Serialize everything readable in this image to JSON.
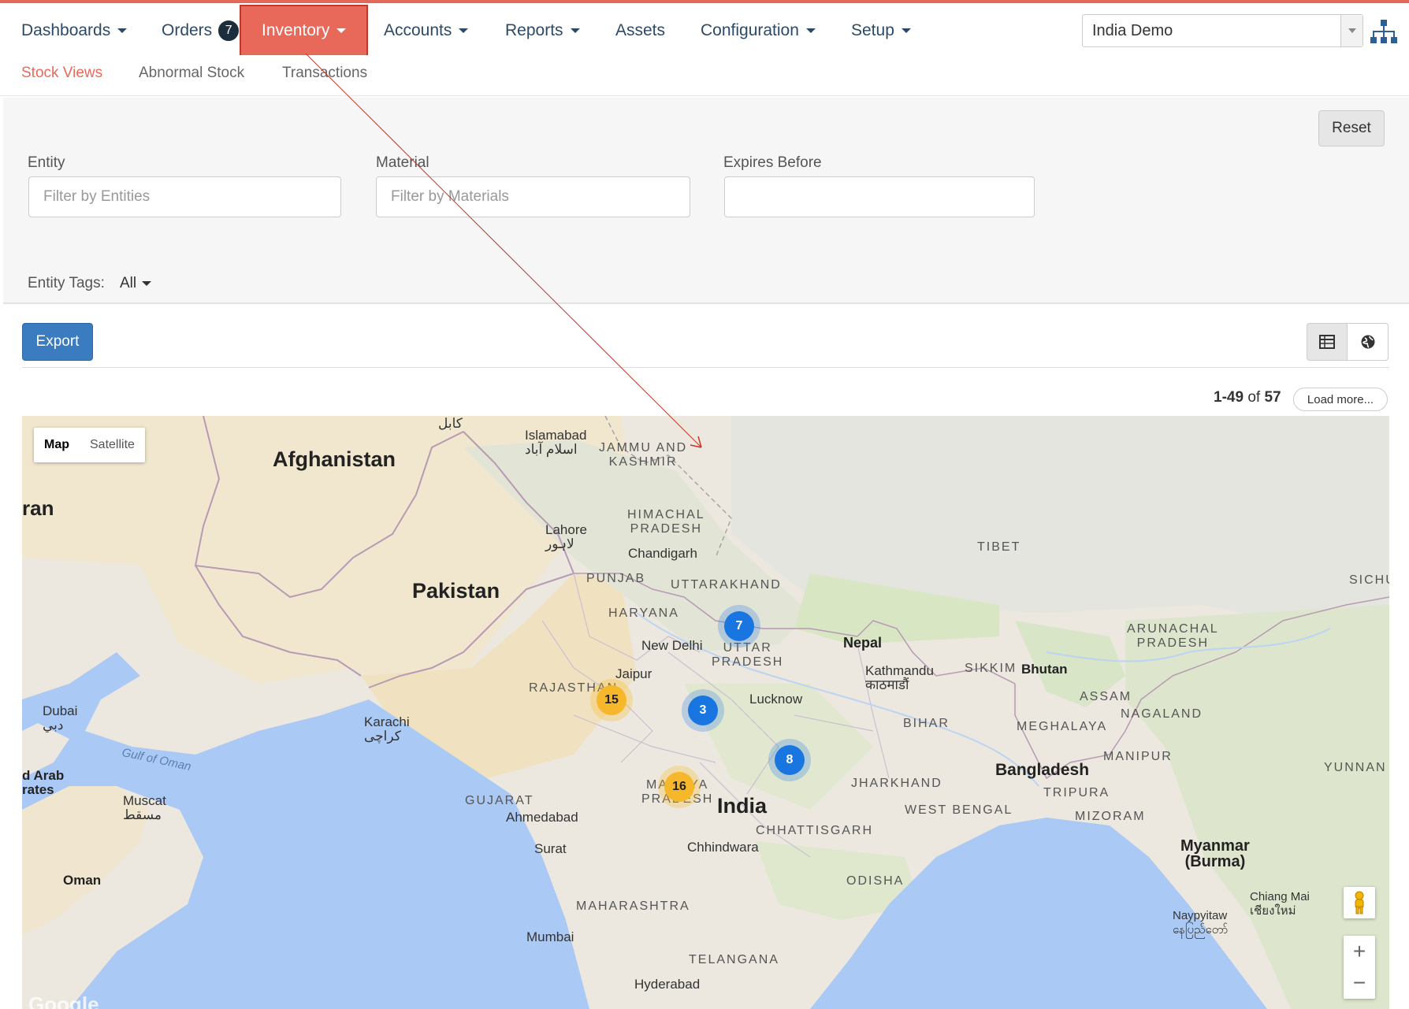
{
  "nav": {
    "items": [
      {
        "label": "Dashboards",
        "caret": true
      },
      {
        "label": "Orders",
        "badge": "7"
      },
      {
        "label": "Inventory",
        "caret": true,
        "active": true
      },
      {
        "label": "Accounts",
        "caret": true
      },
      {
        "label": "Reports",
        "caret": true
      },
      {
        "label": "Assets"
      },
      {
        "label": "Configuration",
        "caret": true
      },
      {
        "label": "Setup",
        "caret": true
      }
    ],
    "domain": "India Demo"
  },
  "subnav": {
    "items": [
      {
        "label": "Stock Views",
        "active": true
      },
      {
        "label": "Abnormal Stock"
      },
      {
        "label": "Transactions"
      }
    ]
  },
  "filters": {
    "reset_label": "Reset",
    "entity_label": "Entity",
    "entity_placeholder": "Filter by Entities",
    "material_label": "Material",
    "material_placeholder": "Filter by Materials",
    "expires_label": "Expires Before",
    "expires_value": "",
    "tags_label": "Entity Tags:",
    "tags_value": "All"
  },
  "actions": {
    "export_label": "Export",
    "view_icons": [
      "table-icon",
      "globe-icon"
    ]
  },
  "pager": {
    "range": "1-49",
    "of": "of",
    "total": "57",
    "load_more": "Load more..."
  },
  "map": {
    "type_buttons": [
      "Map",
      "Satellite"
    ],
    "labels": {
      "afghanistan": "Afghanistan",
      "pakistan": "Pakistan",
      "india": "India",
      "nepal": "Nepal",
      "bhutan": "Bhutan",
      "bangladesh": "Bangladesh",
      "myanmar": "Myanmar\n(Burma)",
      "tibet": "TIBET",
      "iran": "ran",
      "oman": "Oman",
      "uae": "d Arab\nrates",
      "sichuan": "SICHU",
      "yunnan": "YUNNAN",
      "jk": "JAMMU AND\nKASHMIR",
      "hp": "HIMACHAL\nPRADESH",
      "punjab": "PUNJAB",
      "uttarakhand": "UTTARAKHAND",
      "haryana": "HARYANA",
      "up": "UTTAR\nPRADESH",
      "rajasthan": "RAJASTHAN",
      "gujarat": "GUJARAT",
      "mp": "MADHYA\nPRADESH",
      "chhattisgarh": "CHHATTISGARH",
      "jharkhand": "JHARKHAND",
      "bihar": "BIHAR",
      "west_bengal": "WEST BENGAL",
      "odisha": "ODISHA",
      "maharashtra": "MAHARASHTRA",
      "telangana": "TELANGANA",
      "sikkim": "SIKKIM",
      "arunachal": "ARUNACHAL\nPRADESH",
      "assam": "ASSAM",
      "meghalaya": "MEGHALAYA",
      "nagaland": "NAGALAND",
      "manipur": "MANIPUR",
      "tripura": "TRIPURA",
      "mizoram": "MIZORAM",
      "islamabad": "Islamabad\nاسلام آباد",
      "kabul": "کابل",
      "lahore": "Lahore\nلاہور",
      "chandigarh": "Chandigarh",
      "new_delhi": "New Delhi",
      "jaipur": "Jaipur",
      "lucknow": "Lucknow",
      "kathmandu": "Kathmandu\nकाठमाडौं",
      "karachi": "Karachi\nکراچی",
      "dubai": "Dubai\nدبي",
      "muscat": "Muscat\nمسقط",
      "ahmedabad": "Ahmedabad",
      "surat": "Surat",
      "chhindwara": "Chhindwara",
      "mumbai": "Mumbai",
      "hyderabad": "Hyderabad",
      "naypyitaw": "Naypyitaw\nနေပြည်တော်",
      "chiang_mai": "Chiang Mai\nเชียงใหม่",
      "gulf_of_oman": "Gulf of Oman"
    },
    "clusters": [
      {
        "count": "7",
        "color": "blue"
      },
      {
        "count": "15",
        "color": "orange"
      },
      {
        "count": "3",
        "color": "blue"
      },
      {
        "count": "8",
        "color": "blue"
      },
      {
        "count": "16",
        "color": "orange"
      }
    ],
    "zoom_in": "+",
    "zoom_out": "−",
    "attribution": "Google"
  },
  "colors": {
    "accent": "#e8695a",
    "nav_text": "#2c4a67",
    "primary": "#3b7bbf",
    "annotation": "#c0392b"
  }
}
